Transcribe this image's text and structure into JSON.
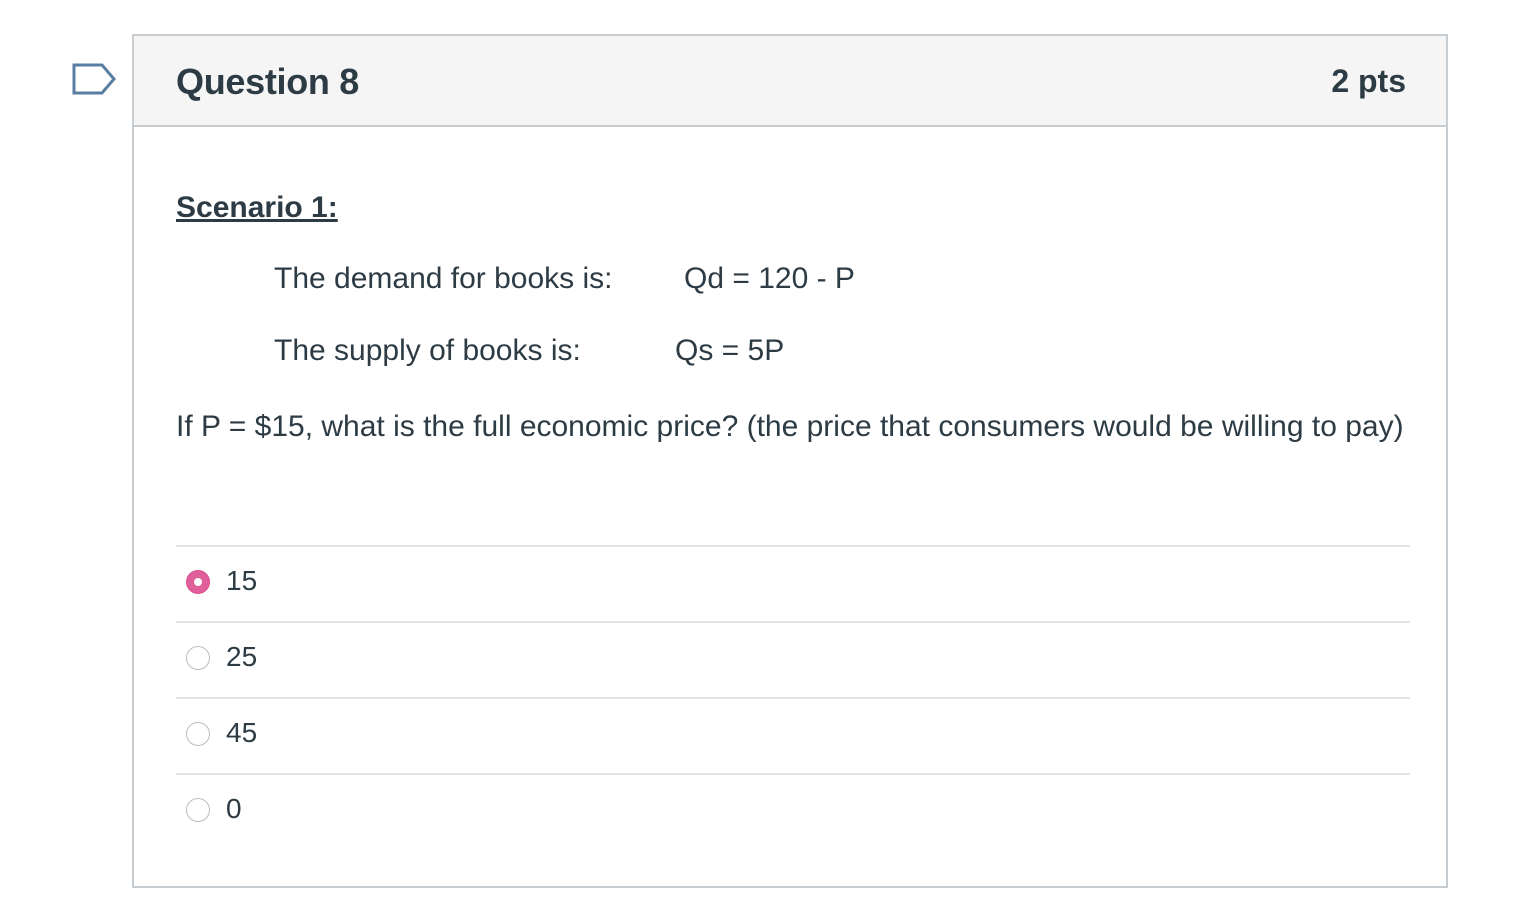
{
  "question": {
    "title": "Question 8",
    "points": "2 pts"
  },
  "scenario": {
    "heading": "Scenario 1:",
    "demand_label": "The demand for books is:",
    "demand_equation": "Qd = 120 - P",
    "supply_label": "The supply of books is:",
    "supply_equation": "Qs = 5P"
  },
  "prompt": "If P = $15, what is the full economic price? (the price that consumers would be willing to pay)",
  "answers": [
    {
      "label": "15",
      "selected": true
    },
    {
      "label": "25",
      "selected": false
    },
    {
      "label": "45",
      "selected": false
    },
    {
      "label": "0",
      "selected": false
    }
  ],
  "colors": {
    "selected_radio": "#e05f9b",
    "flag_outline": "#5a7ea3",
    "border": "#c7cdd1",
    "header_bg": "#f5f5f5"
  },
  "icons": {
    "flag": "flag-question-icon"
  }
}
